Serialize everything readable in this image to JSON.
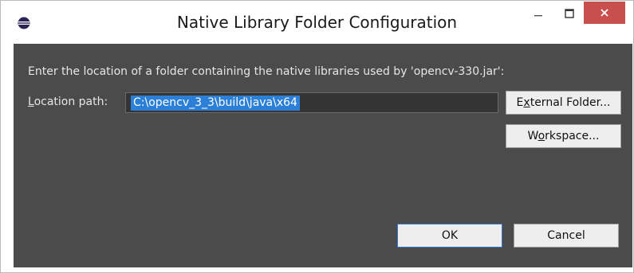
{
  "window": {
    "title": "Native Library Folder Configuration",
    "colors": {
      "titlebar": "#ffffff",
      "body": "#4b4b4b",
      "close": "#c7504f",
      "selection": "#2b7fd6"
    }
  },
  "icons": {
    "app": "eclipse-icon",
    "minimize": "minimize-icon",
    "maximize": "maximize-icon",
    "close": "close-icon"
  },
  "dialog": {
    "description": "Enter the location of a folder containing the native libraries used by 'opencv-330.jar':",
    "location_label_first": "L",
    "location_label_rest": "ocation path:",
    "location_value": "C:\\opencv_3_3\\build\\java\\x64"
  },
  "buttons": {
    "external_pre": "E",
    "external_mnemonic": "x",
    "external_post": "ternal Folder...",
    "workspace_pre": "W",
    "workspace_mnemonic": "o",
    "workspace_post": "rkspace...",
    "ok": "OK",
    "cancel": "Cancel"
  }
}
